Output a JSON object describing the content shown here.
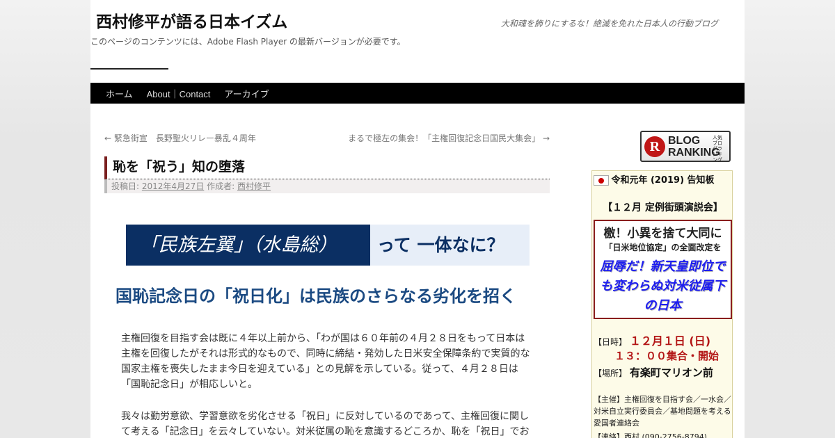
{
  "header": {
    "site_title": "西村修平が語る日本イズム",
    "site_description": "大和魂を飾りにするな！絶滅を免れた日本人の行動ブログ",
    "flash_note": "このページのコンテンツには、Adobe Flash Player の最新バージョンが必要です。"
  },
  "nav": {
    "items": [
      {
        "label": "ホーム"
      },
      {
        "label": "About｜Contact"
      },
      {
        "label": "アーカイブ"
      }
    ]
  },
  "post_nav": {
    "prev": "← 緊急街宣　長野聖火リレー暴乱４周年",
    "next": "まるで極左の集会！「主権回復記念日国民大集会」 →"
  },
  "post": {
    "title": "恥を「祝う」知の堕落",
    "meta_posted": "投稿日:",
    "meta_date": "2012年4月27日",
    "meta_author_label": "作成者:",
    "meta_author": "西村修平",
    "banner_left": "「民族左翼」（水島総）",
    "banner_right": "って 一体なに？",
    "headline": "国恥記念日の「祝日化」は民族のさらなる劣化を招く",
    "paragraph1": "主権回復を目指す会は既に４年以上前から、「わが国は６０年前の４月２８日をもって日本は主権を回復したがそれは形式的なもので、同時に締結・発効した日米安全保障条約で実質的な国家主権を喪失したまま今日を迎えている」との見解を示している。従って、４月２８日は「国恥記念日」が相応しいと。",
    "paragraph2": "我々は勤労意欲、学習意欲を劣化させる「祝日」に反対しているのであって、主権回復に関して考える「記念日」を云々していない。対米従属の恥を意識するどころか、恥を「祝日」でお"
  },
  "sidebar": {
    "blog_ranking": {
      "mark": "R",
      "line1": "BLOG",
      "line2": "RANKING",
      "tiny": "人気ブログランキング"
    },
    "notice": {
      "title": "令和元年 (2019) 告知板",
      "subtitle": "【１２月 定例街頭演説会】",
      "slogan1": "檄！小異を捨て大同に",
      "slogan2": "「日米地位協定」の全面改定を",
      "slogan3": "屈辱だ！新天皇即位でも変わらぬ対米従属下の日本",
      "date_label": "【日時】",
      "date_value": "１２月１日 (日)",
      "time_value": "１３：００集合・開始",
      "place_label": "【場所】",
      "place_value": "有楽町マリオン前",
      "organizer": "【主催】主権回復を目指す会／一水会／対米自立実行委員会／基地問題を考える愛国者連絡会",
      "contact": "【連絡】西村 (090-2756-8794)"
    }
  }
}
